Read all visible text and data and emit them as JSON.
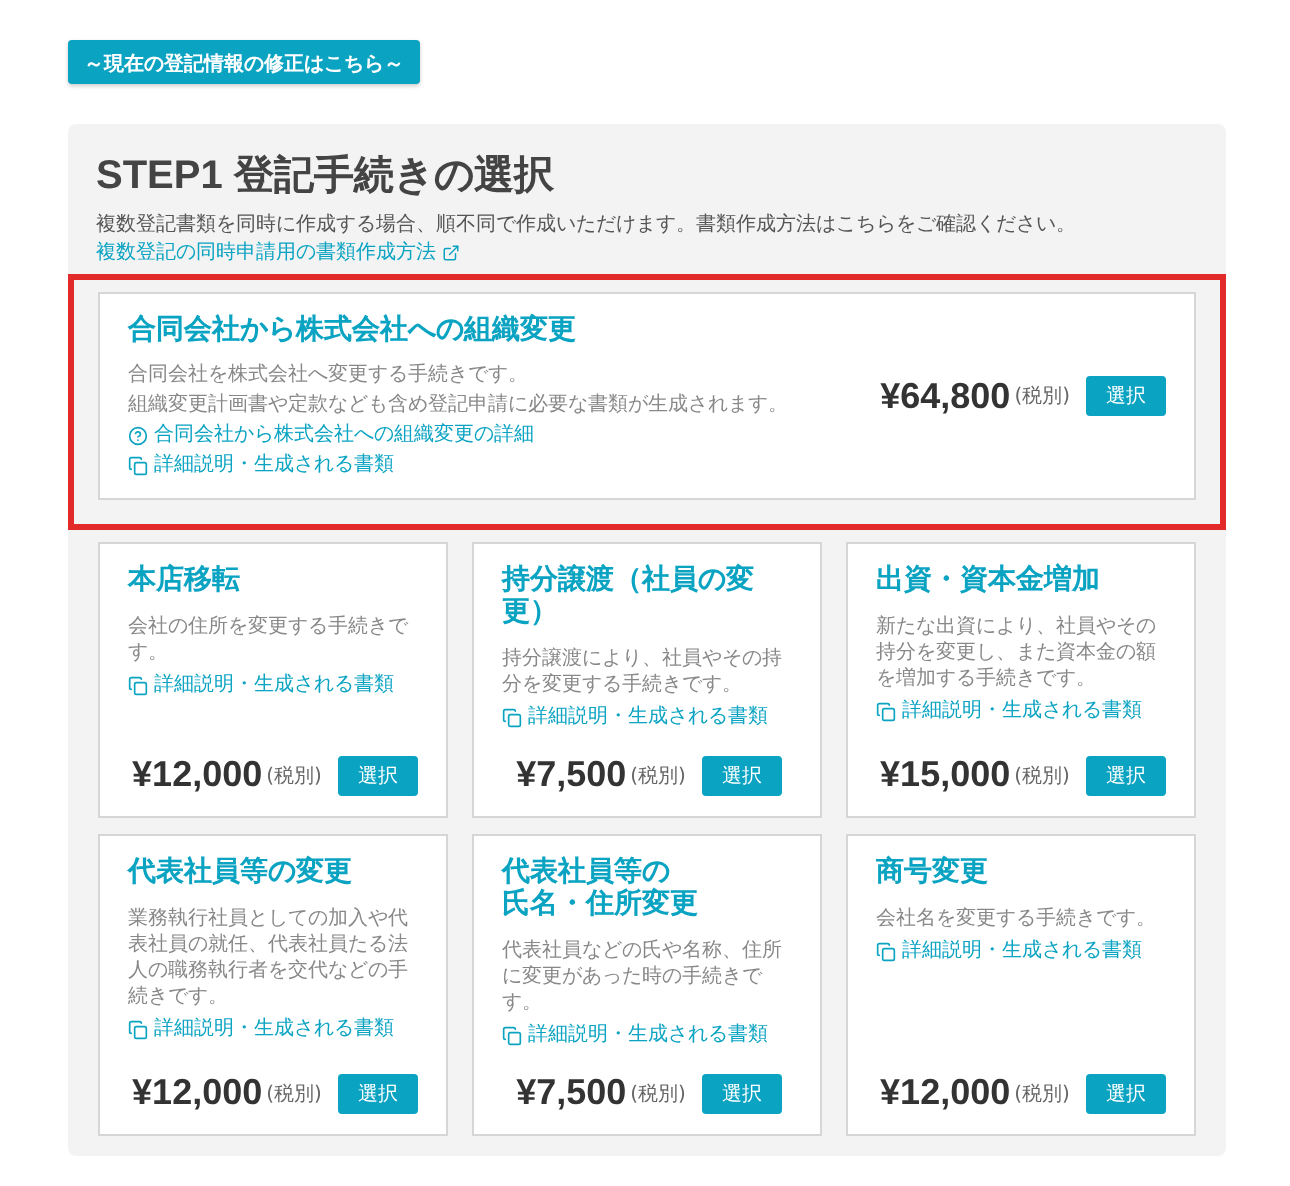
{
  "top_button": "～現在の登記情報の修正はこちら～",
  "step": {
    "title": "STEP1 登記手続きの選択",
    "note": "複数登記書類を同時に作成する場合、順不同で作成いただけます。書類作成方法はこちらをご確認ください。",
    "note_link": "複数登記の同時申請用の書類作成方法"
  },
  "featured": {
    "title": "合同会社から株式会社への組織変更",
    "description": [
      "合同会社を株式会社へ変更する手続きです。",
      "組織変更計画書や定款なども含め登記申請に必要な書類が生成されます。"
    ],
    "help_link": "合同会社から株式会社への組織変更の詳細",
    "detail_link": "詳細説明・生成される書類",
    "price": "¥64,800",
    "tax": "(税別)",
    "button": "選択"
  },
  "cards": [
    {
      "title": [
        "本店移転"
      ],
      "description": "会社の住所を変更する手続きです。",
      "detail_link": "詳細説明・生成される書類",
      "price": "¥12,000",
      "tax": "(税別)",
      "button": "選択"
    },
    {
      "title": [
        "持分譲渡（社員の変更）"
      ],
      "description": "持分譲渡により、社員やその持分を変更する手続きです。",
      "detail_link": "詳細説明・生成される書類",
      "price": "¥7,500",
      "tax": "(税別)",
      "button": "選択"
    },
    {
      "title": [
        "出資・資本金増加"
      ],
      "description": "新たな出資により、社員やその持分を変更し、また資本金の額を増加する手続きです。",
      "detail_link": "詳細説明・生成される書類",
      "price": "¥15,000",
      "tax": "(税別)",
      "button": "選択"
    },
    {
      "title": [
        "代表社員等の変更"
      ],
      "description": "業務執行社員としての加入や代表社員の就任、代表社員たる法人の職務執行者を交代などの手続きです。",
      "detail_link": "詳細説明・生成される書類",
      "price": "¥12,000",
      "tax": "(税別)",
      "button": "選択"
    },
    {
      "title": [
        "代表社員等の",
        "氏名・住所変更"
      ],
      "description": "代表社員などの氏や名称、住所に変更があった時の手続きです。",
      "detail_link": "詳細説明・生成される書類",
      "price": "¥7,500",
      "tax": "(税別)",
      "button": "選択"
    },
    {
      "title": [
        "商号変更"
      ],
      "description": "会社名を変更する手続きです。",
      "detail_link": "詳細説明・生成される書類",
      "price": "¥12,000",
      "tax": "(税別)",
      "button": "選択"
    }
  ]
}
